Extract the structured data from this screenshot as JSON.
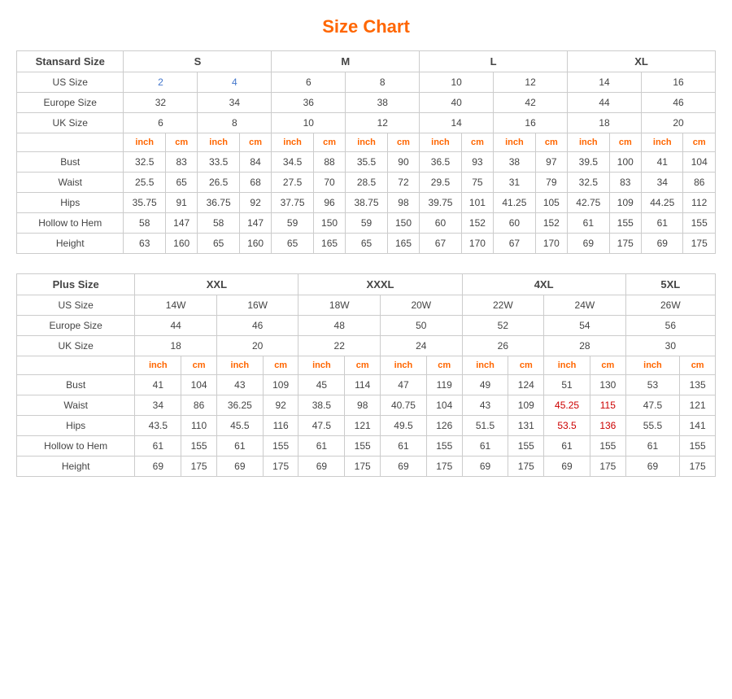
{
  "title": "Size Chart",
  "standard": {
    "section_label": "Stansard Size",
    "size_groups": [
      "S",
      "M",
      "L",
      "XL"
    ],
    "us_size_label": "US Size",
    "europe_size_label": "Europe Size",
    "uk_size_label": "UK Size",
    "us_sizes": [
      "2",
      "4",
      "6",
      "8",
      "10",
      "12",
      "14",
      "16"
    ],
    "europe_sizes": [
      "32",
      "34",
      "36",
      "38",
      "40",
      "42",
      "44",
      "46"
    ],
    "uk_sizes": [
      "6",
      "8",
      "10",
      "12",
      "14",
      "16",
      "18",
      "20"
    ],
    "unit_inch": "inch",
    "unit_cm": "cm",
    "rows": [
      {
        "label": "Bust",
        "values": [
          "32.5",
          "83",
          "33.5",
          "84",
          "34.5",
          "88",
          "35.5",
          "90",
          "36.5",
          "93",
          "38",
          "97",
          "39.5",
          "100",
          "41",
          "104"
        ]
      },
      {
        "label": "Waist",
        "values": [
          "25.5",
          "65",
          "26.5",
          "68",
          "27.5",
          "70",
          "28.5",
          "72",
          "29.5",
          "75",
          "31",
          "79",
          "32.5",
          "83",
          "34",
          "86"
        ]
      },
      {
        "label": "Hips",
        "values": [
          "35.75",
          "91",
          "36.75",
          "92",
          "37.75",
          "96",
          "38.75",
          "98",
          "39.75",
          "101",
          "41.25",
          "105",
          "42.75",
          "109",
          "44.25",
          "112"
        ]
      },
      {
        "label": "Hollow to Hem",
        "values": [
          "58",
          "147",
          "58",
          "147",
          "59",
          "150",
          "59",
          "150",
          "60",
          "152",
          "60",
          "152",
          "61",
          "155",
          "61",
          "155"
        ]
      },
      {
        "label": "Height",
        "values": [
          "63",
          "160",
          "65",
          "160",
          "65",
          "165",
          "65",
          "165",
          "67",
          "170",
          "67",
          "170",
          "69",
          "175",
          "69",
          "175"
        ]
      }
    ]
  },
  "plus": {
    "section_label": "Plus Size",
    "size_groups": [
      "XXL",
      "XXXL",
      "4XL",
      "5XL"
    ],
    "us_size_label": "US Size",
    "europe_size_label": "Europe Size",
    "uk_size_label": "UK Size",
    "us_sizes": [
      "14W",
      "16W",
      "18W",
      "20W",
      "22W",
      "24W",
      "26W"
    ],
    "europe_sizes": [
      "44",
      "46",
      "48",
      "50",
      "52",
      "54",
      "56"
    ],
    "uk_sizes": [
      "18",
      "20",
      "22",
      "24",
      "26",
      "28",
      "30"
    ],
    "unit_inch": "inch",
    "unit_cm": "cm",
    "rows": [
      {
        "label": "Bust",
        "values": [
          "41",
          "104",
          "43",
          "109",
          "45",
          "114",
          "47",
          "119",
          "49",
          "124",
          "51",
          "130",
          "53",
          "135"
        ]
      },
      {
        "label": "Waist",
        "values": [
          "34",
          "86",
          "36.25",
          "92",
          "38.5",
          "98",
          "40.75",
          "104",
          "43",
          "109",
          "45.25",
          "115",
          "47.5",
          "121"
        ]
      },
      {
        "label": "Hips",
        "values": [
          "43.5",
          "110",
          "45.5",
          "116",
          "47.5",
          "121",
          "49.5",
          "126",
          "51.5",
          "131",
          "53.5",
          "136",
          "55.5",
          "141"
        ]
      },
      {
        "label": "Hollow to Hem",
        "values": [
          "61",
          "155",
          "61",
          "155",
          "61",
          "155",
          "61",
          "155",
          "61",
          "155",
          "61",
          "155",
          "61",
          "155"
        ]
      },
      {
        "label": "Height",
        "values": [
          "69",
          "175",
          "69",
          "175",
          "69",
          "175",
          "69",
          "175",
          "69",
          "175",
          "69",
          "175",
          "69",
          "175"
        ]
      }
    ]
  }
}
